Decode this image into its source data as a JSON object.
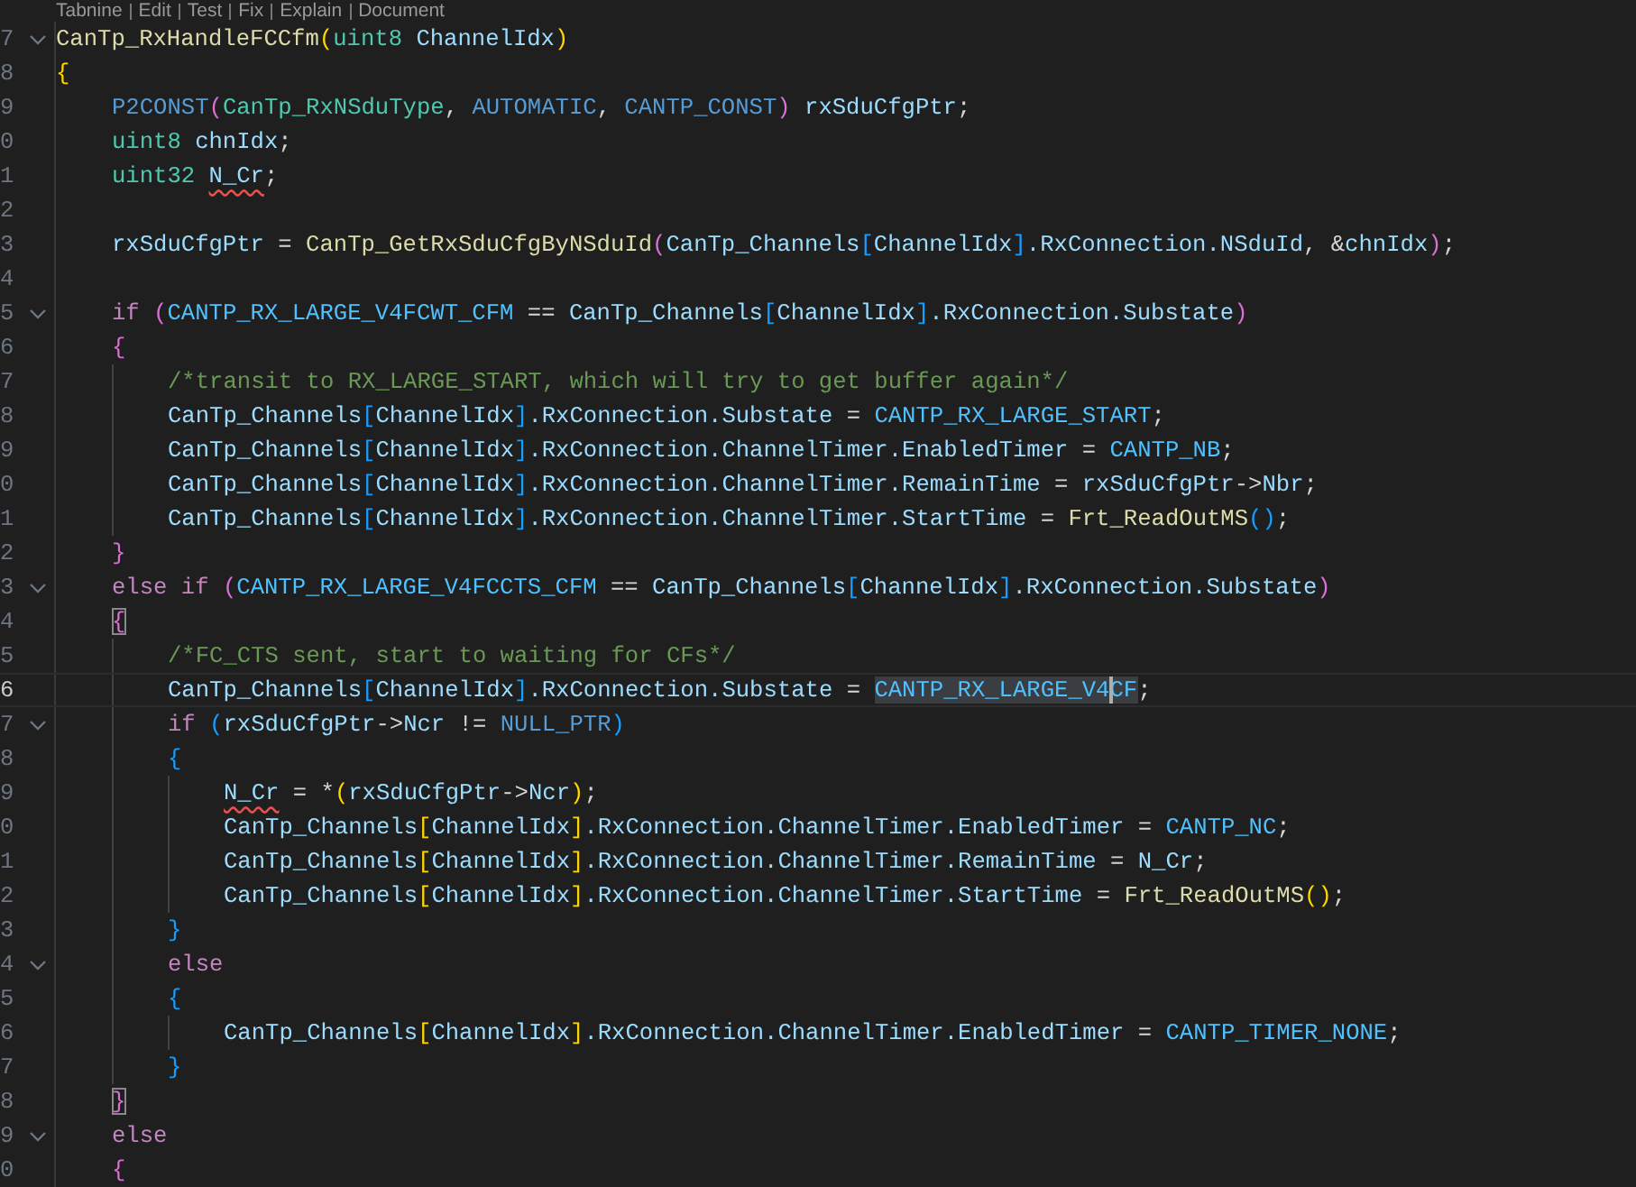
{
  "codelens": [
    "Tabnine",
    "Edit",
    "Test",
    "Fix",
    "Explain",
    "Document"
  ],
  "lines": [
    {
      "number": "7",
      "foldable": true,
      "tokens": [
        {
          "text": "CanTp_RxHandleFCCfm",
          "kind": "fn"
        },
        {
          "text": "(",
          "kind": "b1"
        },
        {
          "text": "uint8 ",
          "kind": "type"
        },
        {
          "text": "ChannelIdx",
          "kind": "var"
        },
        {
          "text": ")",
          "kind": "b1"
        }
      ]
    },
    {
      "number": "8",
      "tokens": [
        {
          "text": "{",
          "kind": "b1"
        }
      ],
      "children": [
        {
          "number": "9",
          "tokens": [
            {
              "text": "P2CONST",
              "kind": "macro"
            },
            {
              "text": "(",
              "kind": "b2"
            },
            {
              "text": "CanTp_RxNSduType",
              "kind": "type"
            },
            {
              "text": ", ",
              "kind": "p"
            },
            {
              "text": "AUTOMATIC",
              "kind": "macro"
            },
            {
              "text": ", ",
              "kind": "p"
            },
            {
              "text": "CANTP_CONST",
              "kind": "macro"
            },
            {
              "text": ") ",
              "kind": "b2"
            },
            {
              "text": "rxSduCfgPtr",
              "kind": "var"
            },
            {
              "text": ";",
              "kind": "p"
            }
          ]
        },
        {
          "number": "0",
          "tokens": [
            {
              "text": "uint8 ",
              "kind": "type"
            },
            {
              "text": "chnIdx",
              "kind": "var"
            },
            {
              "text": ";",
              "kind": "p"
            }
          ]
        },
        {
          "number": "1",
          "tokens": [
            {
              "text": "uint32 ",
              "kind": "type"
            },
            {
              "text": "N_Cr",
              "kind": "var",
              "error": true
            },
            {
              "text": ";",
              "kind": "p"
            }
          ]
        },
        {
          "number": "2"
        },
        {
          "number": "3",
          "tokens": [
            {
              "text": "rxSduCfgPtr",
              "kind": "var"
            },
            {
              "text": " = ",
              "kind": "p"
            },
            {
              "text": "CanTp_GetRxSduCfgByNSduId",
              "kind": "fn"
            },
            {
              "text": "(",
              "kind": "b2"
            },
            {
              "text": "CanTp_Channels",
              "kind": "var"
            },
            {
              "text": "[",
              "kind": "b3"
            },
            {
              "text": "ChannelIdx",
              "kind": "var"
            },
            {
              "text": "]",
              "kind": "b3"
            },
            {
              "text": ".RxConnection.NSduId",
              "kind": "var"
            },
            {
              "text": ", &",
              "kind": "p"
            },
            {
              "text": "chnIdx",
              "kind": "var"
            },
            {
              "text": ")",
              "kind": "b2"
            },
            {
              "text": ";",
              "kind": "p"
            }
          ]
        },
        {
          "number": "4"
        },
        {
          "number": "5",
          "foldable": true,
          "tokens": [
            {
              "text": "if ",
              "kind": "kw"
            },
            {
              "text": "(",
              "kind": "b2"
            },
            {
              "text": "CANTP_RX_LARGE_V4FCWT_CFM",
              "kind": "const"
            },
            {
              "text": " == ",
              "kind": "p"
            },
            {
              "text": "CanTp_Channels",
              "kind": "var"
            },
            {
              "text": "[",
              "kind": "b3"
            },
            {
              "text": "ChannelIdx",
              "kind": "var"
            },
            {
              "text": "]",
              "kind": "b3"
            },
            {
              "text": ".RxConnection.Substate",
              "kind": "var"
            },
            {
              "text": ")",
              "kind": "b2"
            }
          ]
        },
        {
          "number": "6",
          "tokens": [
            {
              "text": "{",
              "kind": "b2"
            }
          ],
          "children": [
            {
              "number": "7",
              "tokens": [
                {
                  "text": "/*transit to RX_LARGE_START, which will try to get buffer again*/",
                  "kind": "comment"
                }
              ]
            },
            {
              "number": "8",
              "tokens": [
                {
                  "text": "CanTp_Channels",
                  "kind": "var"
                },
                {
                  "text": "[",
                  "kind": "b3"
                },
                {
                  "text": "ChannelIdx",
                  "kind": "var"
                },
                {
                  "text": "]",
                  "kind": "b3"
                },
                {
                  "text": ".RxConnection.Substate",
                  "kind": "var"
                },
                {
                  "text": " = ",
                  "kind": "p"
                },
                {
                  "text": "CANTP_RX_LARGE_START",
                  "kind": "const"
                },
                {
                  "text": ";",
                  "kind": "p"
                }
              ]
            },
            {
              "number": "9",
              "tokens": [
                {
                  "text": "CanTp_Channels",
                  "kind": "var"
                },
                {
                  "text": "[",
                  "kind": "b3"
                },
                {
                  "text": "ChannelIdx",
                  "kind": "var"
                },
                {
                  "text": "]",
                  "kind": "b3"
                },
                {
                  "text": ".RxConnection.ChannelTimer.EnabledTimer",
                  "kind": "var"
                },
                {
                  "text": " = ",
                  "kind": "p"
                },
                {
                  "text": "CANTP_NB",
                  "kind": "const"
                },
                {
                  "text": ";",
                  "kind": "p"
                }
              ]
            },
            {
              "number": "0",
              "tokens": [
                {
                  "text": "CanTp_Channels",
                  "kind": "var"
                },
                {
                  "text": "[",
                  "kind": "b3"
                },
                {
                  "text": "ChannelIdx",
                  "kind": "var"
                },
                {
                  "text": "]",
                  "kind": "b3"
                },
                {
                  "text": ".RxConnection.ChannelTimer.RemainTime",
                  "kind": "var"
                },
                {
                  "text": " = ",
                  "kind": "p"
                },
                {
                  "text": "rxSduCfgPtr",
                  "kind": "var"
                },
                {
                  "text": "->",
                  "kind": "p"
                },
                {
                  "text": "Nbr",
                  "kind": "var"
                },
                {
                  "text": ";",
                  "kind": "p"
                }
              ]
            },
            {
              "number": "1",
              "tokens": [
                {
                  "text": "CanTp_Channels",
                  "kind": "var"
                },
                {
                  "text": "[",
                  "kind": "b3"
                },
                {
                  "text": "ChannelIdx",
                  "kind": "var"
                },
                {
                  "text": "]",
                  "kind": "b3"
                },
                {
                  "text": ".RxConnection.ChannelTimer.StartTime",
                  "kind": "var"
                },
                {
                  "text": " = ",
                  "kind": "p"
                },
                {
                  "text": "Frt_ReadOutMS",
                  "kind": "fn"
                },
                {
                  "text": "()",
                  "kind": "b3"
                },
                {
                  "text": ";",
                  "kind": "p"
                }
              ]
            }
          ]
        },
        {
          "number": "2",
          "tokens": [
            {
              "text": "}",
              "kind": "b2"
            }
          ]
        },
        {
          "number": "3",
          "foldable": true,
          "tokens": [
            {
              "text": "else ",
              "kind": "kw"
            },
            {
              "text": "if ",
              "kind": "kw"
            },
            {
              "text": "(",
              "kind": "b2"
            },
            {
              "text": "CANTP_RX_LARGE_V4FCCTS_CFM",
              "kind": "const"
            },
            {
              "text": " == ",
              "kind": "p"
            },
            {
              "text": "CanTp_Channels",
              "kind": "var"
            },
            {
              "text": "[",
              "kind": "b3"
            },
            {
              "text": "ChannelIdx",
              "kind": "var"
            },
            {
              "text": "]",
              "kind": "b3"
            },
            {
              "text": ".RxConnection.Substate",
              "kind": "var"
            },
            {
              "text": ")",
              "kind": "b2"
            }
          ]
        },
        {
          "number": "4",
          "tokens": [
            {
              "text": "{",
              "kind": "b2",
              "matched": true
            }
          ],
          "children": [
            {
              "number": "5",
              "tokens": [
                {
                  "text": "/*FC_CTS sent, start to waiting for CFs*/",
                  "kind": "comment"
                }
              ]
            },
            {
              "number": "6",
              "current": true,
              "tokens": [
                {
                  "text": "CanTp_Channels",
                  "kind": "var"
                },
                {
                  "text": "[",
                  "kind": "b3"
                },
                {
                  "text": "ChannelIdx",
                  "kind": "var"
                },
                {
                  "text": "]",
                  "kind": "b3"
                },
                {
                  "text": ".RxConnection.Substate",
                  "kind": "var"
                },
                {
                  "text": " = ",
                  "kind": "p"
                },
                {
                  "text": "CANTP_RX_LARGE_V4",
                  "kind": "const",
                  "selected": true
                },
                {
                  "text": "CF",
                  "kind": "const",
                  "selected": true,
                  "cursor": true
                },
                {
                  "text": ";",
                  "kind": "p"
                }
              ]
            },
            {
              "number": "7",
              "foldable": true,
              "tokens": [
                {
                  "text": "if ",
                  "kind": "kw"
                },
                {
                  "text": "(",
                  "kind": "b3"
                },
                {
                  "text": "rxSduCfgPtr",
                  "kind": "var"
                },
                {
                  "text": "->",
                  "kind": "p"
                },
                {
                  "text": "Ncr",
                  "kind": "var"
                },
                {
                  "text": " != ",
                  "kind": "p"
                },
                {
                  "text": "NULL_PTR",
                  "kind": "macro"
                },
                {
                  "text": ")",
                  "kind": "b3"
                }
              ]
            },
            {
              "number": "8",
              "tokens": [
                {
                  "text": "{",
                  "kind": "b3"
                }
              ],
              "children": [
                {
                  "number": "9",
                  "tokens": [
                    {
                      "text": "N_Cr",
                      "kind": "var",
                      "error": true
                    },
                    {
                      "text": " = *",
                      "kind": "p"
                    },
                    {
                      "text": "(",
                      "kind": "b1"
                    },
                    {
                      "text": "rxSduCfgPtr",
                      "kind": "var"
                    },
                    {
                      "text": "->",
                      "kind": "p"
                    },
                    {
                      "text": "Ncr",
                      "kind": "var"
                    },
                    {
                      "text": ")",
                      "kind": "b1"
                    },
                    {
                      "text": ";",
                      "kind": "p"
                    }
                  ]
                },
                {
                  "number": "0",
                  "tokens": [
                    {
                      "text": "CanTp_Channels",
                      "kind": "var"
                    },
                    {
                      "text": "[",
                      "kind": "b1"
                    },
                    {
                      "text": "ChannelIdx",
                      "kind": "var"
                    },
                    {
                      "text": "]",
                      "kind": "b1"
                    },
                    {
                      "text": ".RxConnection.ChannelTimer.EnabledTimer",
                      "kind": "var"
                    },
                    {
                      "text": " = ",
                      "kind": "p"
                    },
                    {
                      "text": "CANTP_NC",
                      "kind": "const"
                    },
                    {
                      "text": ";",
                      "kind": "p"
                    }
                  ]
                },
                {
                  "number": "1",
                  "tokens": [
                    {
                      "text": "CanTp_Channels",
                      "kind": "var"
                    },
                    {
                      "text": "[",
                      "kind": "b1"
                    },
                    {
                      "text": "ChannelIdx",
                      "kind": "var"
                    },
                    {
                      "text": "]",
                      "kind": "b1"
                    },
                    {
                      "text": ".RxConnection.ChannelTimer.RemainTime",
                      "kind": "var"
                    },
                    {
                      "text": " = ",
                      "kind": "p"
                    },
                    {
                      "text": "N_Cr",
                      "kind": "var"
                    },
                    {
                      "text": ";",
                      "kind": "p"
                    }
                  ]
                },
                {
                  "number": "2",
                  "tokens": [
                    {
                      "text": "CanTp_Channels",
                      "kind": "var"
                    },
                    {
                      "text": "[",
                      "kind": "b1"
                    },
                    {
                      "text": "ChannelIdx",
                      "kind": "var"
                    },
                    {
                      "text": "]",
                      "kind": "b1"
                    },
                    {
                      "text": ".RxConnection.ChannelTimer.StartTime",
                      "kind": "var"
                    },
                    {
                      "text": " = ",
                      "kind": "p"
                    },
                    {
                      "text": "Frt_ReadOutMS",
                      "kind": "fn"
                    },
                    {
                      "text": "()",
                      "kind": "b1"
                    },
                    {
                      "text": ";",
                      "kind": "p"
                    }
                  ]
                }
              ]
            },
            {
              "number": "3",
              "tokens": [
                {
                  "text": "}",
                  "kind": "b3"
                }
              ]
            },
            {
              "number": "4",
              "foldable": true,
              "tokens": [
                {
                  "text": "else",
                  "kind": "kw"
                }
              ]
            },
            {
              "number": "5",
              "tokens": [
                {
                  "text": "{",
                  "kind": "b3"
                }
              ],
              "children": [
                {
                  "number": "6",
                  "tokens": [
                    {
                      "text": "CanTp_Channels",
                      "kind": "var"
                    },
                    {
                      "text": "[",
                      "kind": "b1"
                    },
                    {
                      "text": "ChannelIdx",
                      "kind": "var"
                    },
                    {
                      "text": "]",
                      "kind": "b1"
                    },
                    {
                      "text": ".RxConnection.ChannelTimer.EnabledTimer",
                      "kind": "var"
                    },
                    {
                      "text": " = ",
                      "kind": "p"
                    },
                    {
                      "text": "CANTP_TIMER_NONE",
                      "kind": "const"
                    },
                    {
                      "text": ";",
                      "kind": "p"
                    }
                  ]
                }
              ]
            },
            {
              "number": "7",
              "tokens": [
                {
                  "text": "}",
                  "kind": "b3"
                }
              ]
            }
          ]
        },
        {
          "number": "8",
          "tokens": [
            {
              "text": "}",
              "kind": "b2",
              "matched": true
            }
          ]
        },
        {
          "number": "9",
          "foldable": true,
          "tokens": [
            {
              "text": "else",
              "kind": "kw"
            }
          ]
        },
        {
          "number": "0",
          "tokens": [
            {
              "text": "{",
              "kind": "b2"
            }
          ]
        }
      ]
    }
  ]
}
